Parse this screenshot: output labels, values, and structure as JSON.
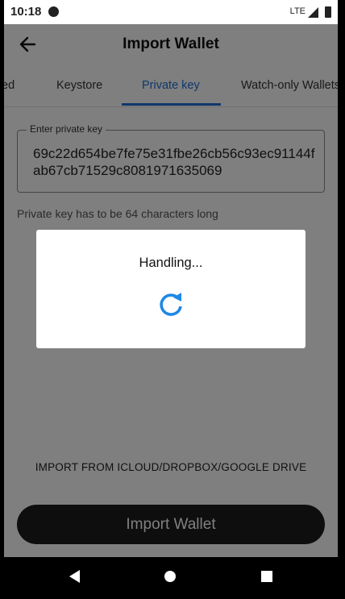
{
  "status_bar": {
    "time": "10:18",
    "network": "LTE"
  },
  "app_bar": {
    "title": "Import Wallet"
  },
  "tabs": [
    {
      "label": "ed",
      "active": false
    },
    {
      "label": "Keystore",
      "active": false
    },
    {
      "label": "Private key",
      "active": true
    },
    {
      "label": "Watch-only Wallets",
      "active": false
    }
  ],
  "private_key_field": {
    "label": "Enter private key",
    "value": "69c22d654be7fe75e31fbe26cb56c93ec91144fab67cb71529c8081971635069"
  },
  "helper_text": "Private key has to be 64 characters long",
  "import_link": "IMPORT FROM ICLOUD/DROPBOX/GOOGLE DRIVE",
  "import_button": "Import Wallet",
  "dialog": {
    "message": "Handling..."
  },
  "colors": {
    "accent": "#1f6fd6",
    "spinner": "#1e88e5",
    "button": "#1c1c1c"
  }
}
